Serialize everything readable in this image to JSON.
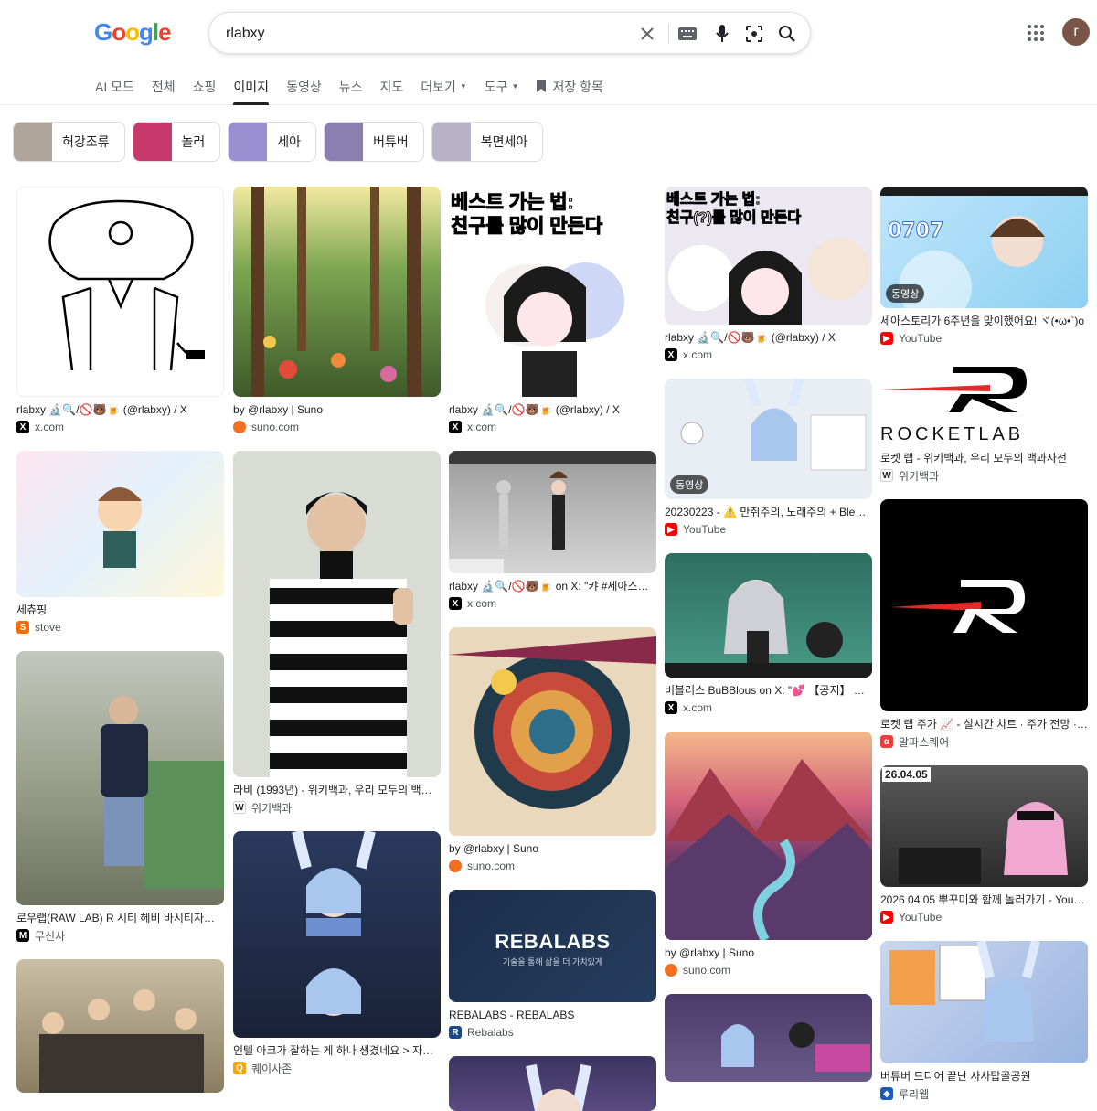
{
  "search": {
    "query": "rlabxy"
  },
  "logo": [
    "G",
    "o",
    "o",
    "g",
    "l",
    "e"
  ],
  "avatar_initial": "r",
  "tabs": [
    {
      "label": "AI 모드"
    },
    {
      "label": "전체"
    },
    {
      "label": "쇼핑"
    },
    {
      "label": "이미지"
    },
    {
      "label": "동영상"
    },
    {
      "label": "뉴스"
    },
    {
      "label": "지도"
    },
    {
      "label": "더보기"
    },
    {
      "label": "도구"
    },
    {
      "label": "저장 항목"
    }
  ],
  "chips": [
    {
      "label": "허강조류",
      "color": "#b0a59a"
    },
    {
      "label": "놀러",
      "color": "#c83a6b"
    },
    {
      "label": "세아",
      "color": "#9a8fd0"
    },
    {
      "label": "버튜버",
      "color": "#8b7fb0"
    },
    {
      "label": "복면세아",
      "color": "#b9b3c9"
    }
  ],
  "results": {
    "c1": [
      {
        "caption": "rlabxy 🔬🔍/🚫🐻🍺 (@rlabxy) / X",
        "source": "x.com",
        "fav": "X",
        "favcolor": "#000000",
        "bg": "#ffffff",
        "art": "controller"
      },
      {
        "caption": "세츄핑",
        "source": "stove",
        "fav": "S",
        "favcolor": "#ff6b00",
        "bg": "#f4f0f7",
        "art": "doodle"
      },
      {
        "caption": "로우랩(RAW LAB) R 시티 헤비 바시티자켓 (…",
        "source": "무신사",
        "fav": "M",
        "favcolor": "#000000",
        "bg": "#9aa08a",
        "art": "photo1"
      },
      {
        "caption": "",
        "source": "",
        "fav": "",
        "favcolor": "#000000",
        "bg": "#a89a7c",
        "art": "group"
      }
    ],
    "c2": [
      {
        "caption": "by @rlabxy | Suno",
        "source": "suno.com",
        "fav": "●",
        "favcolor": "#f36f21",
        "bg": "#3e5a2a",
        "art": "forest"
      },
      {
        "caption": "라비 (1993년) - 위키백과, 우리 모두의 백과사전",
        "source": "위키백과",
        "fav": "W",
        "favcolor": "#333333",
        "bg": "#d8dcd4",
        "art": "person"
      },
      {
        "caption": "인텔 아크가 잘하는 게 하나 생겼네요 > 자유게…",
        "source": "퀘이사존",
        "fav": "Q",
        "favcolor": "#f7a600",
        "bg": "#2a3a5e",
        "art": "vtuber"
      }
    ],
    "c3": [
      {
        "caption": "rlabxy 🔬🔍/🚫🐻🍺 (@rlabxy) / X",
        "source": "x.com",
        "fav": "X",
        "favcolor": "#000000",
        "bg": "#ffffff",
        "art": "chibi1",
        "text": "베스트 가는 법:\n친구를 많이 만든다"
      },
      {
        "caption": "rlabxy 🔬🔍/🚫🐻🍺 on X: \"캬 #세아스토…",
        "source": "x.com",
        "fav": "X",
        "favcolor": "#000000",
        "bg": "#d9d9d9",
        "art": "model3d"
      },
      {
        "caption": "by @rlabxy | Suno",
        "source": "suno.com",
        "fav": "●",
        "favcolor": "#f36f21",
        "bg": "#c8b89a",
        "art": "abstract"
      },
      {
        "caption": "REBALABS - REBALABS",
        "source": "Rebalabs",
        "fav": "R",
        "favcolor": "#1b4a8a",
        "bg": "#1a2e4a",
        "art": "rebalabs",
        "title": "REBALABS",
        "subtitle": "기술을 통해 삶을 더 가치있게"
      },
      {
        "caption": "",
        "source": "",
        "fav": "",
        "favcolor": "#000",
        "bg": "#3b3560",
        "art": "vtuber2"
      }
    ],
    "c4": [
      {
        "caption": "rlabxy 🔬🔍/🚫🐻🍺 (@rlabxy) / X",
        "source": "x.com",
        "fav": "X",
        "favcolor": "#000000",
        "bg": "#ece8f2",
        "art": "chibi2",
        "text": "베스트 가는 법:\n친구(?)를 많이 만든다"
      },
      {
        "caption": "20230223 - ⚠️ 만취주의, 노래주의 + Bleak…",
        "source": "YouTube",
        "fav": "▶",
        "favcolor": "#ff0000",
        "bg": "#e9eef5",
        "art": "stream1",
        "badge": "동영상"
      },
      {
        "caption": "버블러스 BuBBlous on X: \"💕 【공지】 오늘…",
        "source": "x.com",
        "fav": "X",
        "favcolor": "#000000",
        "bg": "#3f8a7a",
        "art": "stream2"
      },
      {
        "caption": "by @rlabxy | Suno",
        "source": "suno.com",
        "fav": "●",
        "favcolor": "#f36f21",
        "bg": "#a04050",
        "art": "mountains"
      },
      {
        "caption": "",
        "source": "",
        "fav": "",
        "favcolor": "#000",
        "bg": "#4b3b6b",
        "art": "stream3"
      }
    ],
    "c5": [
      {
        "caption": "세아스토리가 6주년을 맞이했어요! ヾ(•ω•`)o",
        "source": "YouTube",
        "fav": "▶",
        "favcolor": "#ff0000",
        "bg": "#9fd5f3",
        "art": "seaday",
        "badge": "동영상"
      },
      {
        "caption": "로켓 랩 - 위키백과, 우리 모두의 백과사전",
        "source": "위키백과",
        "fav": "W",
        "favcolor": "#333333",
        "bg": "#ffffff",
        "art": "rocketlab",
        "title": "ROCKETLAB"
      },
      {
        "caption": "로켓 랩 주가 📈 - 실시간 차트 · 주가 전망 · 투…",
        "source": "알파스퀘어",
        "fav": "α",
        "favcolor": "#e8403a",
        "bg": "#000000",
        "art": "rocketlogo"
      },
      {
        "caption": "2026 04 05 뿌꾸미와 함께 놀러가기 - YouTube",
        "source": "YouTube",
        "fav": "▶",
        "favcolor": "#ff0000",
        "bg": "#4a4a4a",
        "art": "car",
        "badge_text": "26.04.05"
      },
      {
        "caption": "버튜버 드디어 끝난 사사탑골공원",
        "source": "루리웹",
        "fav": "◆",
        "favcolor": "#1c5bb7",
        "bg": "#c9d7ef",
        "art": "sasa"
      }
    ]
  }
}
